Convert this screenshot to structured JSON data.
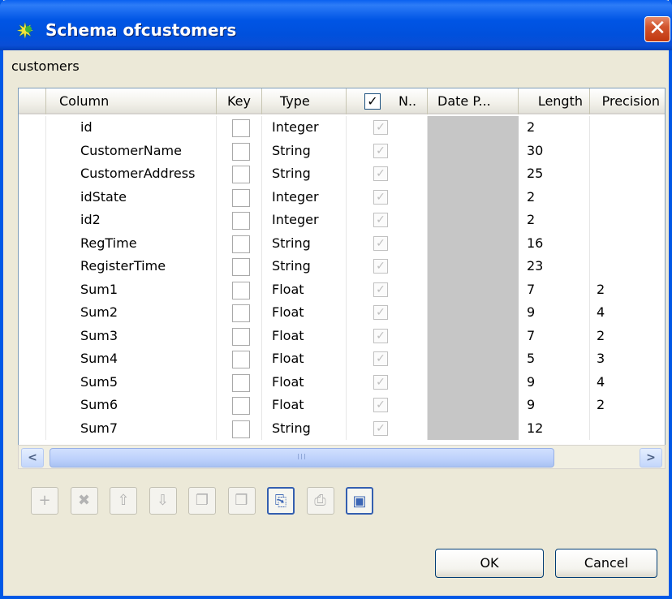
{
  "window": {
    "title": "Schema ofcustomers",
    "close_glyph": "✕"
  },
  "subtitle": "customers",
  "table": {
    "headers": {
      "column": "Column",
      "key": "Key",
      "type": "Type",
      "nullable_check": "✓",
      "nullable": "N..",
      "date_pattern": "Date P...",
      "length": "Length",
      "precision": "Precision"
    },
    "rows": [
      {
        "column": "id",
        "type": "Integer",
        "length": "2",
        "precision": ""
      },
      {
        "column": "CustomerName",
        "type": "String",
        "length": "30",
        "precision": ""
      },
      {
        "column": "CustomerAddress",
        "type": "String",
        "length": "25",
        "precision": ""
      },
      {
        "column": "idState",
        "type": "Integer",
        "length": "2",
        "precision": ""
      },
      {
        "column": "id2",
        "type": "Integer",
        "length": "2",
        "precision": ""
      },
      {
        "column": "RegTime",
        "type": "String",
        "length": "16",
        "precision": ""
      },
      {
        "column": "RegisterTime",
        "type": "String",
        "length": "23",
        "precision": ""
      },
      {
        "column": "Sum1",
        "type": "Float",
        "length": "7",
        "precision": "2"
      },
      {
        "column": "Sum2",
        "type": "Float",
        "length": "9",
        "precision": "4"
      },
      {
        "column": "Sum3",
        "type": "Float",
        "length": "7",
        "precision": "2"
      },
      {
        "column": "Sum4",
        "type": "Float",
        "length": "5",
        "precision": "3"
      },
      {
        "column": "Sum5",
        "type": "Float",
        "length": "9",
        "precision": "4"
      },
      {
        "column": "Sum6",
        "type": "Float",
        "length": "9",
        "precision": "2"
      },
      {
        "column": "Sum7",
        "type": "String",
        "length": "12",
        "precision": ""
      }
    ]
  },
  "scrollbar": {
    "left_glyph": "<",
    "right_glyph": ">",
    "grip_glyph": "III"
  },
  "toolbar": [
    {
      "name": "add-button",
      "icon": "plus-icon",
      "glyph": "+",
      "active": false
    },
    {
      "name": "remove-button",
      "icon": "x-icon",
      "glyph": "✖",
      "active": false
    },
    {
      "name": "move-up-button",
      "icon": "arrow-up-icon",
      "glyph": "⇧",
      "active": false
    },
    {
      "name": "move-down-button",
      "icon": "arrow-down-icon",
      "glyph": "⇩",
      "active": false
    },
    {
      "name": "copy-button",
      "icon": "copy-icon",
      "glyph": "❐",
      "active": false
    },
    {
      "name": "paste-button",
      "icon": "paste-icon",
      "glyph": "❒",
      "active": false
    },
    {
      "name": "import-button",
      "icon": "import-icon",
      "glyph": "⎘",
      "active": true
    },
    {
      "name": "export-button",
      "icon": "export-icon",
      "glyph": "⎙",
      "active": false
    },
    {
      "name": "save-button",
      "icon": "save-icon",
      "glyph": "▣",
      "active": true
    }
  ],
  "buttons": {
    "ok": "OK",
    "cancel": "Cancel"
  },
  "colors": {
    "titlebar": "#0055e5",
    "window_border": "#0058e6",
    "dialog_bg": "#ece9d8",
    "date_cell": "#c6c6c6",
    "scroll_thumb": "#bcd0fb"
  }
}
